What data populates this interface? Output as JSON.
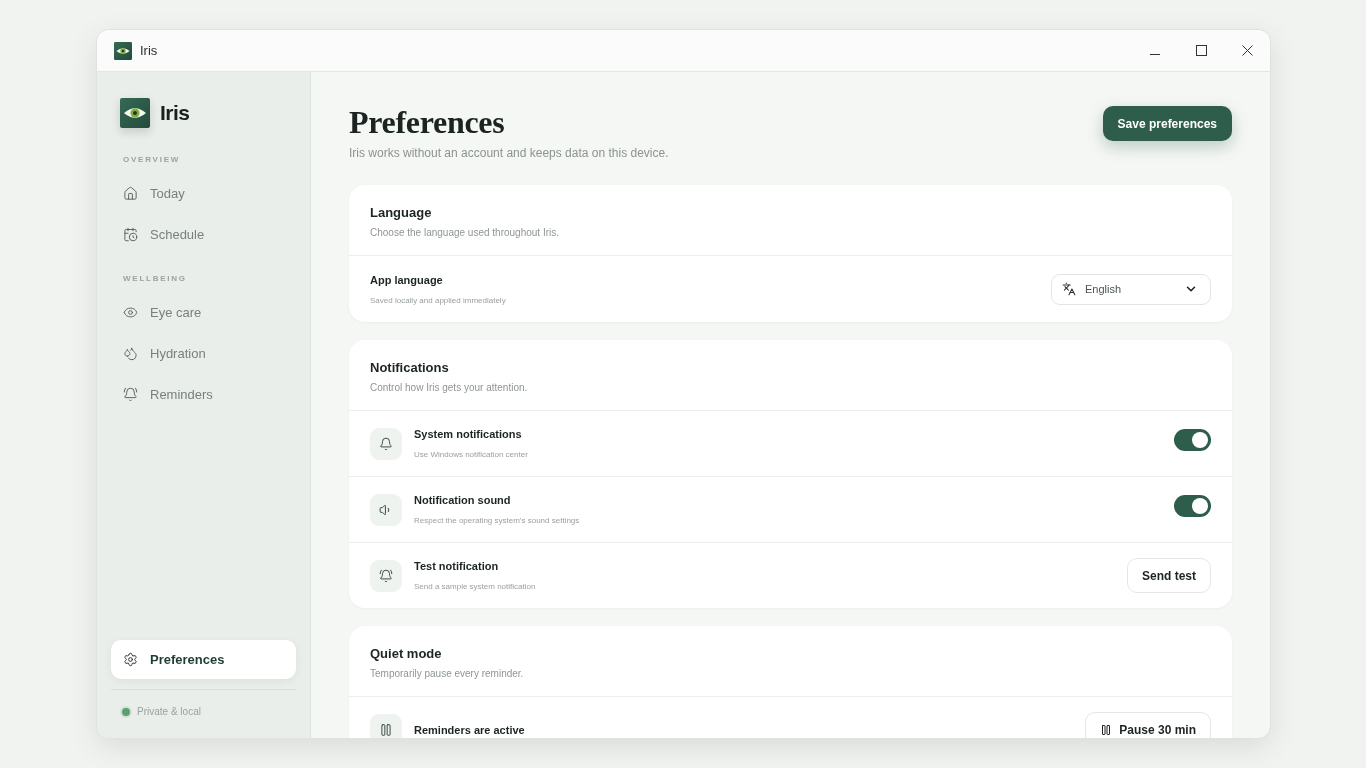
{
  "window": {
    "title": "Iris"
  },
  "sidebar": {
    "brand": "Iris",
    "sections": [
      {
        "heading": "OVERVIEW",
        "items": [
          {
            "label": "Today",
            "selected": false
          },
          {
            "label": "Schedule",
            "selected": false
          }
        ]
      },
      {
        "heading": "WELLBEING",
        "items": [
          {
            "label": "Eye care",
            "selected": false
          },
          {
            "label": "Hydration",
            "selected": false
          },
          {
            "label": "Reminders",
            "selected": false
          }
        ]
      }
    ],
    "footer_item": {
      "label": "Preferences",
      "selected": true
    },
    "status": "Private & local"
  },
  "header": {
    "title": "Preferences",
    "subtitle": "Iris works without an account and keeps data on this device.",
    "save_button": "Save preferences"
  },
  "cards": [
    {
      "title": "Language",
      "subtitle": "Choose the language used throughout Iris.",
      "rows": [
        {
          "kind": "select",
          "title": "App language",
          "subtitle": "Saved locally and applied immediately",
          "value": "English"
        }
      ]
    },
    {
      "title": "Notifications",
      "subtitle": "Control how Iris gets your attention.",
      "rows": [
        {
          "kind": "toggle",
          "title": "System notifications",
          "subtitle": "Use Windows notification center",
          "on": true
        },
        {
          "kind": "toggle",
          "title": "Notification sound",
          "subtitle": "Respect the operating system’s sound settings",
          "on": true
        },
        {
          "kind": "button",
          "title": "Test notification",
          "subtitle": "Send a sample system notification",
          "button": "Send test"
        }
      ]
    },
    {
      "title": "Quiet mode",
      "subtitle": "Temporarily pause every reminder.",
      "rows": [
        {
          "kind": "button",
          "title": "Reminders are active",
          "button": "Pause 30 min"
        }
      ]
    }
  ]
}
